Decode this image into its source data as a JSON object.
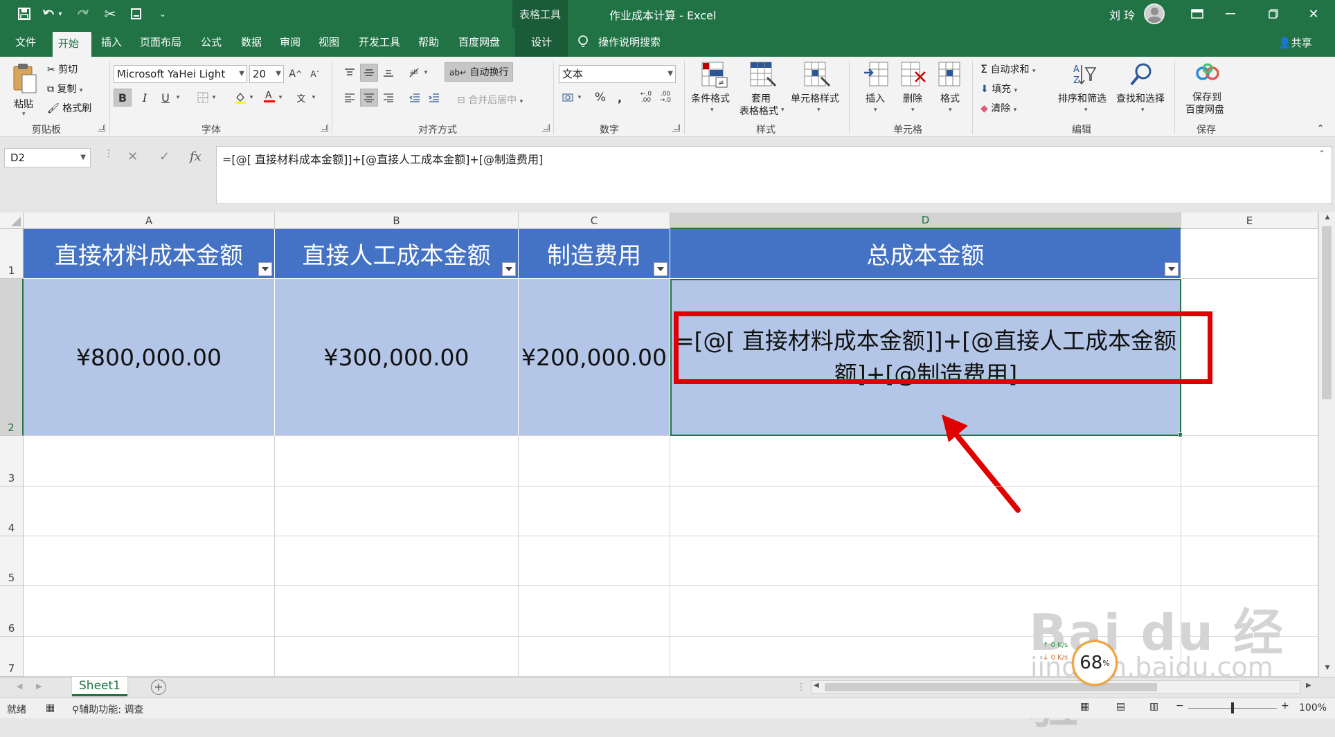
{
  "titlebar": {
    "context_tab": "表格工具",
    "title": "作业成本计算  -  Excel",
    "user": "刘 玲"
  },
  "ribbon_tabs": [
    "文件",
    "开始",
    "插入",
    "页面布局",
    "公式",
    "数据",
    "审阅",
    "视图",
    "开发工具",
    "帮助",
    "百度网盘",
    "设计"
  ],
  "tell_me": "操作说明搜索",
  "share": "共享",
  "clipboard": {
    "paste": "粘贴",
    "cut": "剪切",
    "copy": "复制",
    "format_painter": "格式刷",
    "label": "剪贴板"
  },
  "font": {
    "name": "Microsoft YaHei Light",
    "size": "20",
    "bold": "B",
    "italic": "I",
    "underline": "U",
    "label": "字体"
  },
  "alignment": {
    "wrap": "自动换行",
    "merge": "合并后居中",
    "label": "对齐方式"
  },
  "number": {
    "format": "文本",
    "label": "数字"
  },
  "styles": {
    "conditional": "条件格式",
    "table_fmt_1": "套用",
    "table_fmt_2": "表格格式",
    "cell_styles": "单元格样式",
    "label": "样式"
  },
  "cells": {
    "insert": "插入",
    "delete": "删除",
    "format": "格式",
    "label": "单元格"
  },
  "editing": {
    "autosum": "自动求和",
    "fill": "填充",
    "clear": "清除",
    "sort": "排序和筛选",
    "find": "查找和选择",
    "label": "编辑"
  },
  "save": {
    "line1": "保存到",
    "line2": "百度网盘",
    "label": "保存"
  },
  "formula_bar": {
    "name_box": "D2",
    "formula": "=[@[ 直接材料成本金额]]+[@直接人工成本金额]+[@制造费用]"
  },
  "columns": [
    "A",
    "B",
    "C",
    "D",
    "E"
  ],
  "rows": [
    "1",
    "2",
    "3",
    "4",
    "5",
    "6",
    "7"
  ],
  "table": {
    "headers": [
      "直接材料成本金额",
      "直接人工成本金额",
      "制造费用",
      "总成本金额"
    ],
    "row2": [
      "¥800,000.00",
      "¥300,000.00",
      "¥200,000.00"
    ],
    "d2_line1": "=[@[ 直接材料成本金额]]+[@直接人工成本金额",
    "d2_line2": "额]+[@制造费用]"
  },
  "sheet_tab": "Sheet1",
  "status": {
    "ready": "就绪",
    "accessibility": "辅助功能: 调查",
    "zoom": "100%",
    "net_up": "0  K/s",
    "net_down": "0  K/s",
    "cpu": "68",
    "cpu_unit": "%"
  },
  "watermark": {
    "brand": "Bai du 经验",
    "url": "jingyan.baidu.com"
  },
  "colors": {
    "excel_green": "#217346",
    "header_blue": "#4472c4",
    "data_blue": "#b4c6e7",
    "highlight_red": "#e00000"
  }
}
